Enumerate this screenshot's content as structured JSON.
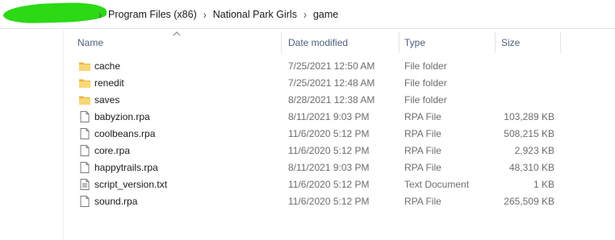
{
  "breadcrumb": {
    "parts": [
      "Program Files (x86)",
      "National Park Girls",
      "game"
    ],
    "separator": "›"
  },
  "columns": {
    "name": "Name",
    "date_modified": "Date modified",
    "type": "Type",
    "size": "Size",
    "sorted_by": "name",
    "sort_direction": "ascending"
  },
  "files": [
    {
      "name": "cache",
      "date": "7/25/2021 12:50 AM",
      "type": "File folder",
      "size": "",
      "icon": "folder-icon"
    },
    {
      "name": "renedit",
      "date": "7/25/2021 12:48 AM",
      "type": "File folder",
      "size": "",
      "icon": "folder-icon"
    },
    {
      "name": "saves",
      "date": "8/28/2021 12:38 AM",
      "type": "File folder",
      "size": "",
      "icon": "folder-icon"
    },
    {
      "name": "babyzion.rpa",
      "date": "8/11/2021 9:03 PM",
      "type": "RPA File",
      "size": "103,289 KB",
      "icon": "file-icon"
    },
    {
      "name": "coolbeans.rpa",
      "date": "11/6/2020 5:12 PM",
      "type": "RPA File",
      "size": "508,215 KB",
      "icon": "file-icon"
    },
    {
      "name": "core.rpa",
      "date": "11/6/2020 5:12 PM",
      "type": "RPA File",
      "size": "2,923 KB",
      "icon": "file-icon"
    },
    {
      "name": "happytrails.rpa",
      "date": "8/11/2021 9:03 PM",
      "type": "RPA File",
      "size": "48,310 KB",
      "icon": "file-icon"
    },
    {
      "name": "script_version.txt",
      "date": "11/6/2020 5:12 PM",
      "type": "Text Document",
      "size": "1 KB",
      "icon": "text-file-icon"
    },
    {
      "name": "sound.rpa",
      "date": "11/6/2020 5:12 PM",
      "type": "RPA File",
      "size": "265,509 KB",
      "icon": "file-icon"
    }
  ],
  "colors": {
    "header_text": "#4d6082",
    "secondary_text": "#6d6d6d",
    "folder": "#f8d775",
    "redaction": "#2bd915"
  }
}
